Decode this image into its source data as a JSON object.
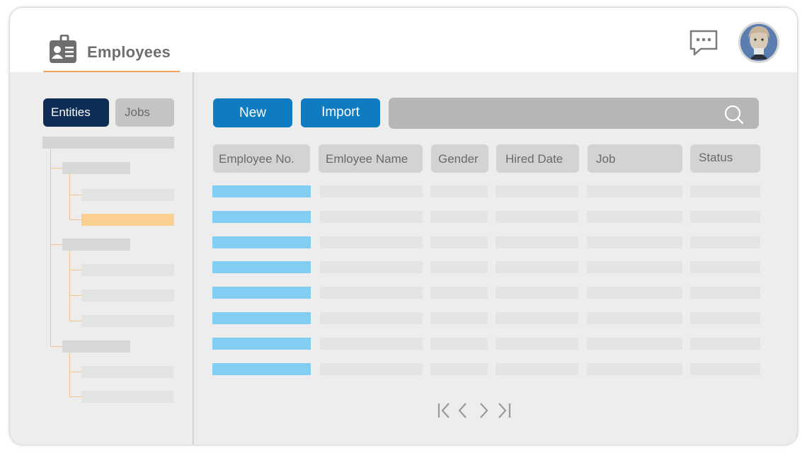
{
  "header": {
    "title": "Employees",
    "app_icon": "employee-id-card-icon",
    "chat_icon": "chat-bubble-icon",
    "avatar": "user-avatar",
    "accent_color": "#f0a35c"
  },
  "sidebar": {
    "tabs": [
      {
        "label": "Entities",
        "active": true
      },
      {
        "label": "Jobs",
        "active": false
      }
    ],
    "tree": {
      "groups": 3,
      "selected_color": "#fbcf8f"
    }
  },
  "toolbar": {
    "new_label": "New",
    "import_label": "Import",
    "search_placeholder": "",
    "search_icon": "search-icon",
    "button_color": "#0f7cc2"
  },
  "table": {
    "columns": [
      "Employee No.",
      "Emloyee Name",
      "Gender",
      "Hired Date",
      "Job",
      "Status"
    ],
    "row_count": 8,
    "highlight_color": "#82cdf2"
  },
  "pagination": {
    "icons": [
      "first-page-icon",
      "previous-page-icon",
      "next-page-icon",
      "last-page-icon"
    ]
  },
  "colors": {
    "tab_active": "#0e2d55",
    "tab_inactive": "#c4c4c4",
    "panel_bg": "#ededed"
  }
}
